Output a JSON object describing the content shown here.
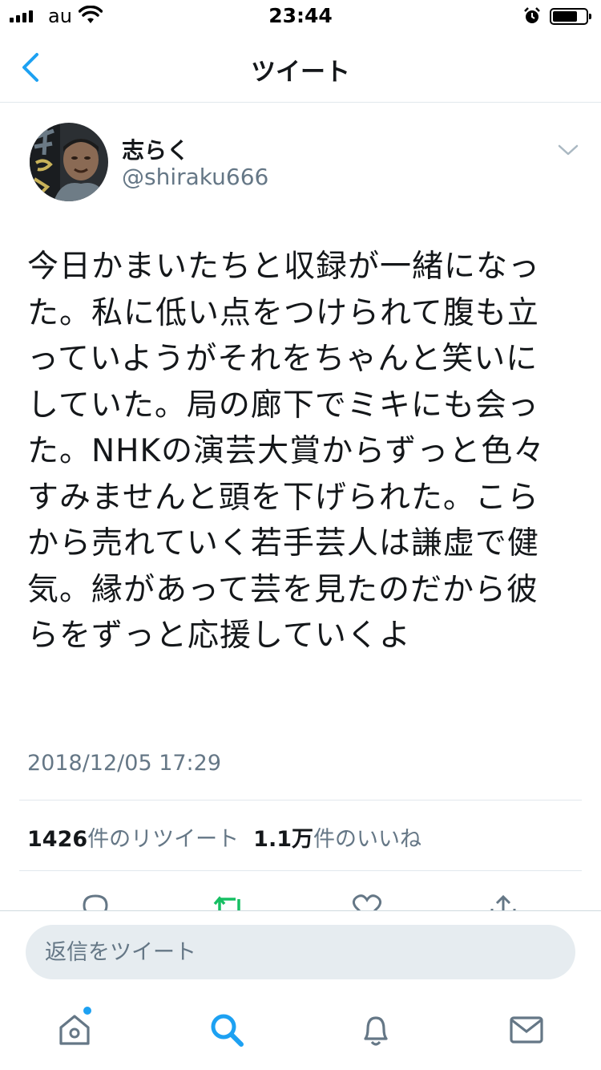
{
  "status_bar": {
    "carrier": "au",
    "time": "23:44"
  },
  "nav": {
    "title": "ツイート"
  },
  "tweet": {
    "display_name": "志らく",
    "handle": "@shiraku666",
    "text": "今日かまいたちと収録が一緒になった。私に低い点をつけられて腹も立っていようがそれをちゃんと笑いにしていた。局の廊下でミキにも会った。NHKの演芸大賞からずっと色々すみませんと頭を下げられた。こらから売れていく若手芸人は謙虚で健気。縁があって芸を見たのだから彼らをずっと応援していくよ",
    "timestamp": "2018/12/05 17:29",
    "retweet_count": "1426",
    "retweet_label": "件のリツイート",
    "like_count": "1.1万",
    "like_label": "件のいいね"
  },
  "reply": {
    "placeholder": "返信をツイート"
  },
  "colors": {
    "accent": "#1da1f2",
    "retweet": "#17bf63",
    "secondary_text": "#657786"
  },
  "icons": {
    "actions": [
      "reply-icon",
      "retweet-icon",
      "like-icon",
      "share-icon"
    ],
    "tabs": [
      "home-icon",
      "search-icon",
      "notifications-icon",
      "messages-icon"
    ]
  }
}
